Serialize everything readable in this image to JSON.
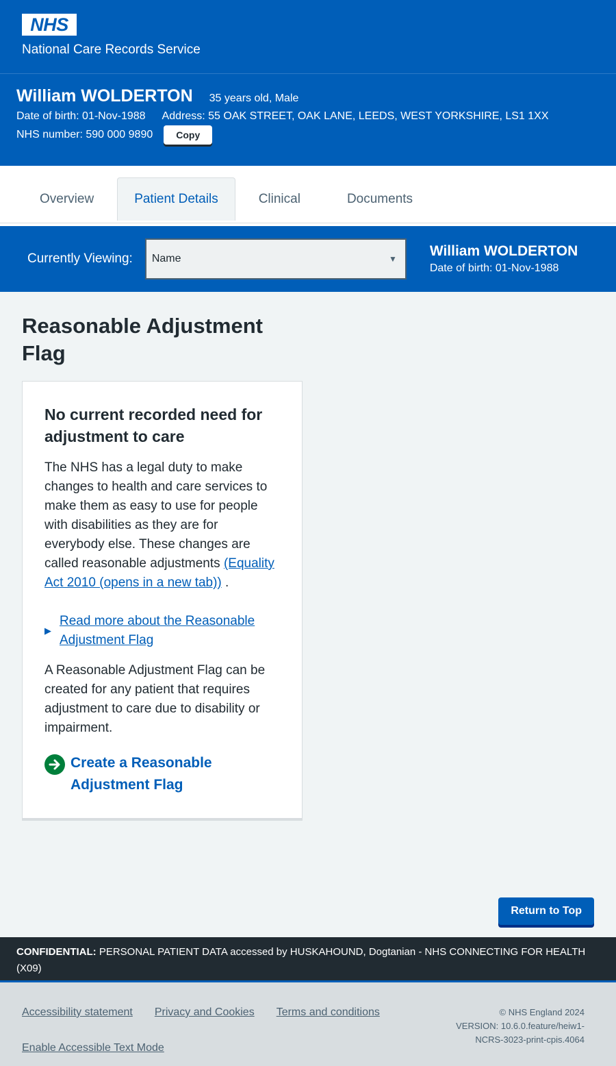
{
  "header": {
    "logo_text": "NHS",
    "service_name": "National Care Records Service"
  },
  "patient_banner": {
    "name": "William WOLDERTON",
    "age_sex": "35 years old, Male",
    "dob": "Date of birth: 01-Nov-1988",
    "address": "Address: 55 OAK STREET, OAK LANE, LEEDS, WEST YORKSHIRE, LS1 1XX",
    "nhs_number": "NHS number: 590 000 9890",
    "copy_label": "Copy"
  },
  "tabs": [
    {
      "label": "Overview",
      "active": false
    },
    {
      "label": "Patient Details",
      "active": true
    },
    {
      "label": "Clinical",
      "active": false
    },
    {
      "label": "Documents",
      "active": false
    }
  ],
  "viewing": {
    "label": "Currently Viewing:",
    "selected": "Name",
    "patient_name": "William WOLDERTON",
    "patient_dob": "Date of birth: 01-Nov-1988"
  },
  "main": {
    "title": "Reasonable Adjustment Flag",
    "card": {
      "heading": "No current recorded need for adjustment to care",
      "intro": "The NHS has a legal duty to make changes to health and care services to make them as easy to use for people with disabilities as they are for everybody else. These changes are called reasonable adjustments ",
      "equality_link": "(Equality Act 2010 (opens in a new tab))",
      "intro_end": " .",
      "details_link": "Read more about the Reasonable Adjustment Flag",
      "body": "A Reasonable Adjustment Flag can be created for any patient that requires adjustment to care due to disability or impairment.",
      "action": "Create a Reasonable Adjustment Flag"
    },
    "return_to_top": "Return to Top"
  },
  "confidential": {
    "label": "CONFIDENTIAL:",
    "text": " PERSONAL PATIENT DATA accessed by HUSKAHOUND, Dogtanian - NHS CONNECTING FOR HEALTH (X09)"
  },
  "footer": {
    "links": [
      "Accessibility statement",
      "Privacy and Cookies",
      "Terms and conditions",
      "Enable Accessible Text Mode"
    ],
    "copyright": "© NHS England 2024",
    "version": "VERSION: 10.6.0.feature/heiw1-NCRS-3023-print-cpis.4064"
  },
  "colors": {
    "nhs_blue": "#005eb8",
    "text": "#212b32",
    "secondary_text": "#4c6272",
    "green": "#007f3b",
    "background": "#f0f4f5"
  }
}
